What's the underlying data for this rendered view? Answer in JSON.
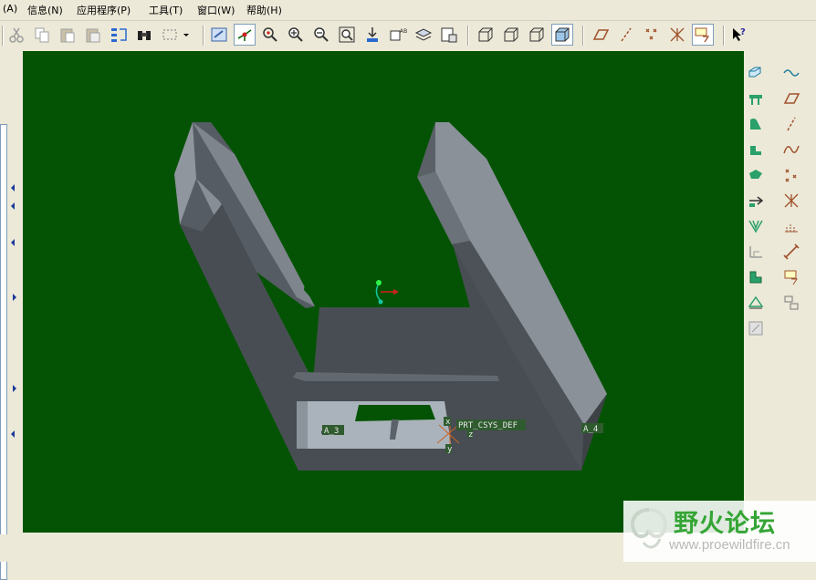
{
  "menu": {
    "items": [
      "(A)",
      "信息(N)",
      "应用程序(P)",
      "工具(T)",
      "窗口(W)",
      "帮助(H)"
    ]
  },
  "toolbar": {
    "buttons": [
      "cut-icon",
      "copy-icon",
      "paste-icon",
      "paste-special-icon",
      "regenerate-icon",
      "find-icon",
      "select-box-icon",
      "dropdown-icon",
      "repaint-icon",
      "spin-center-icon",
      "orient-mode-icon",
      "zoom-in-icon",
      "zoom-out-icon",
      "refit-icon",
      "reorient-icon",
      "saved-views-icon",
      "layers-icon",
      "view-manager-icon",
      "wireframe-icon",
      "hidden-line-icon",
      "no-hidden-icon",
      "shading-icon",
      "datum-planes-icon",
      "datum-axes-icon",
      "datum-points-icon",
      "coordinate-systems-icon",
      "annotations-icon",
      "context-help-icon"
    ]
  },
  "viewport": {
    "background": "#045304",
    "labels": {
      "csys": "PRT_CSYS_DEF",
      "a3": "A_3",
      "a4": "A_4",
      "x": "x",
      "y": "y",
      "z": "z"
    }
  },
  "right_toolbar": {
    "buttons": [
      "extrude-icon",
      "revolve-icon",
      "variable-section-sweep-icon",
      "boundary-blend-icon",
      "style-icon",
      "sketched-curve-icon",
      "datum-plane-tool-icon",
      "datum-axis-tool-icon",
      "datum-point-tool-icon",
      "datum-csys-tool-icon",
      "datum-curve-icon",
      "analysis-icon",
      "rib-icon",
      "draft-icon",
      "round-icon",
      "chamfer-icon",
      "shell-icon",
      "hole-icon",
      "pattern-icon",
      "mirror-icon",
      "merge-icon",
      "trim-icon",
      "offset-icon",
      "thicken-icon",
      "solidify-icon",
      "intersect-icon",
      "project-icon",
      "wrap-icon"
    ]
  },
  "watermark": {
    "title": "野火论坛",
    "url": "www.proewildfire.cn"
  },
  "colors": {
    "accent": "#35a535",
    "model_face_dark": "#4a4f55",
    "model_face_light": "#8a9199"
  }
}
